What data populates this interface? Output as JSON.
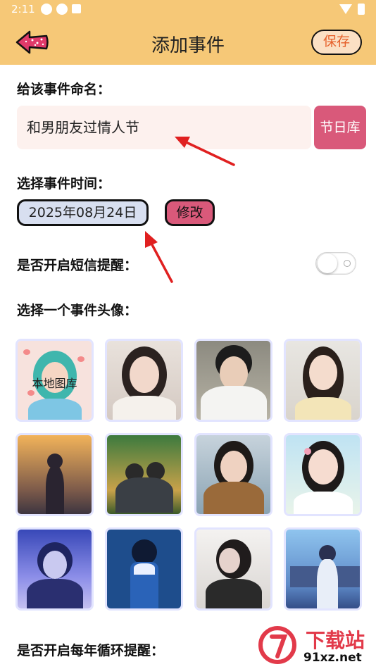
{
  "status_bar": {
    "time": "2:11"
  },
  "header": {
    "title": "添加事件",
    "save_label": "保存"
  },
  "event_name": {
    "label": "给该事件命名：",
    "value": "和男朋友过情人节",
    "holiday_button": "节日库"
  },
  "event_time": {
    "label": "选择事件时间：",
    "value": "2025年08月24日",
    "modify_button": "修改"
  },
  "sms_reminder": {
    "label": "是否开启短信提醒：",
    "enabled": false
  },
  "avatar_section": {
    "label": "选择一个事件头像：",
    "local_gallery_label": "本地图库"
  },
  "yearly_reminder": {
    "label": "是否开启每年循环提醒："
  },
  "watermark": {
    "name": "下载站",
    "site": "91xz.net"
  },
  "colors": {
    "header_bg": "#f6c877",
    "accent": "#d9597a",
    "save_text": "#e6602a",
    "arrow": "#e02020"
  }
}
